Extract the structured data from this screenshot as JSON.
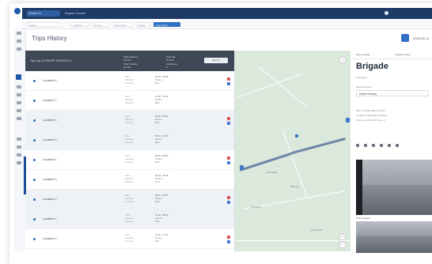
{
  "topbar": {
    "vehicle_select": "Vehicle 01",
    "secondary": "Brigade Connect"
  },
  "filters": [
    "Search",
    "Vehicles",
    "Drivers",
    "Date range",
    "Status"
  ],
  "filter_apply": "Apply filters",
  "page": {
    "title": "Trips History",
    "date_label": "2020-02-11"
  },
  "list": {
    "header_label": "Trip Log: 11 ROUTE VEHICLE 01",
    "stats": [
      {
        "label": "Total distance",
        "value": "128 km"
      },
      {
        "label": "Total duration",
        "value": "4h 32m"
      },
      {
        "label": "Total idle",
        "value": "0h 22m"
      },
      {
        "label": "Total stops",
        "value": "8"
      }
    ],
    "export_label": "Export",
    "rows": [
      {
        "location": "Location 8",
        "shaded": false,
        "meta": [
          "Start",
          "Distance",
          "Duration"
        ],
        "vals": [
          "10:42 - 10:58",
          "5.4 km",
          "16m"
        ]
      },
      {
        "location": "Location 7",
        "shaded": false,
        "meta": [
          "Start",
          "Distance",
          "Duration"
        ],
        "vals": [
          "10:02 - 10:31",
          "8.1 km",
          "29m"
        ]
      },
      {
        "location": "Location 6",
        "shaded": true,
        "meta": [
          "Start",
          "Distance",
          "Duration"
        ],
        "vals": [
          "09:40 - 09:55",
          "4.0 km",
          "15m"
        ]
      },
      {
        "location": "Location 5",
        "shaded": true,
        "meta": [
          "Start",
          "Distance",
          "Duration"
        ],
        "vals": [
          "09:12 - 09:30",
          "6.2 km",
          "18m"
        ]
      },
      {
        "location": "Location 4",
        "shaded": false,
        "meta": [
          "Start",
          "Distance",
          "Duration"
        ],
        "vals": [
          "08:55 - 09:05",
          "3.3 km",
          "10m"
        ]
      },
      {
        "location": "Location 3",
        "shaded": false,
        "meta": [
          "Start",
          "Distance",
          "Duration"
        ],
        "vals": [
          "08:31 - 08:48",
          "5.9 km",
          "17m"
        ]
      },
      {
        "location": "Location 2",
        "shaded": true,
        "meta": [
          "Start",
          "Distance",
          "Duration"
        ],
        "vals": [
          "08:10 - 08:25",
          "4.6 km",
          "15m"
        ]
      },
      {
        "location": "Location 1",
        "shaded": true,
        "meta": [
          "Start",
          "Distance",
          "Duration"
        ],
        "vals": [
          "07:48 - 08:02",
          "4.1 km",
          "14m"
        ]
      },
      {
        "location": "Location 0",
        "shaded": false,
        "meta": [
          "Start",
          "Distance",
          "Duration"
        ],
        "vals": [
          "07:30 - 07:41",
          "3.2 km",
          "11m"
        ]
      }
    ]
  },
  "map": {
    "labels": [
      "Park Road",
      "Mill Lane",
      "Church St",
      "Green Lane"
    ]
  },
  "detail": {
    "tabs": [
      "Event Details",
      "Brigade Video"
    ],
    "brand": "Brigade",
    "section_label": "Trip Event",
    "field_label": "Selected event",
    "field_value": "Harsh Braking",
    "info": [
      "Date: 11-Feb-2020 at 10:51",
      "Location: Park Road, Ashford",
      "Vehicle: Vehicle 01 Driver 4"
    ],
    "video_caption_1": "Front camera",
    "video_caption_2": "Rear camera"
  },
  "colors": {
    "nav_dark": "#1e3a66",
    "accent": "#2f6fc4",
    "list_header": "#3d4756",
    "map_bg": "#dbe8dc",
    "route": "#6c86a8",
    "badge_red": "#d9534f",
    "badge_blue": "#3c78c8"
  }
}
